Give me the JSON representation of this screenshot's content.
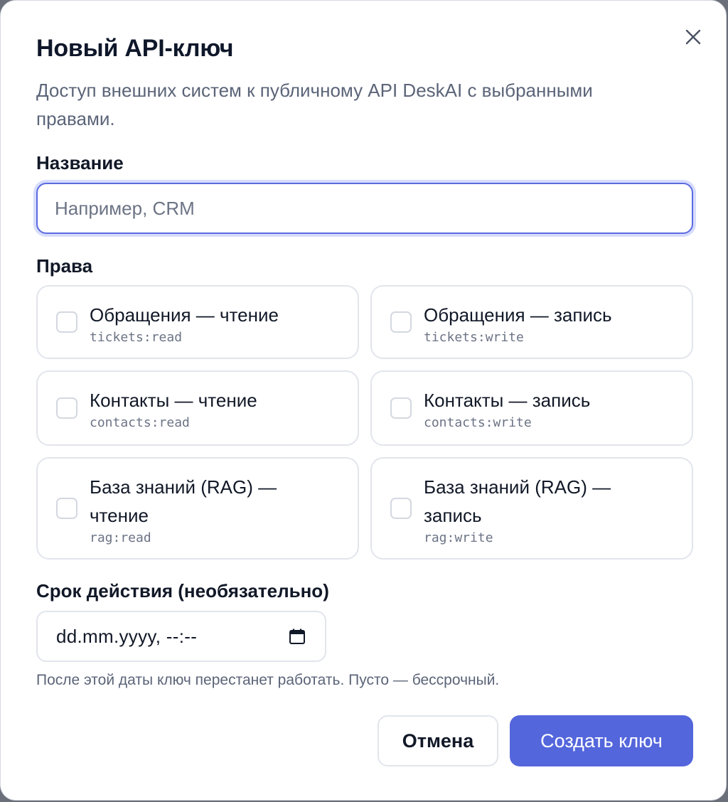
{
  "dialog": {
    "title": "Новый API-ключ",
    "description": "Доступ внешних систем к публичному API DeskAI с выбранными правами."
  },
  "name_field": {
    "label": "Название",
    "placeholder": "Например, CRM",
    "value": ""
  },
  "permissions": {
    "label": "Права",
    "items": [
      {
        "title": "Обращения — чтение",
        "code": "tickets:read",
        "checked": false
      },
      {
        "title": "Обращения — запись",
        "code": "tickets:write",
        "checked": false
      },
      {
        "title": "Контакты — чтение",
        "code": "contacts:read",
        "checked": false
      },
      {
        "title": "Контакты — запись",
        "code": "contacts:write",
        "checked": false
      },
      {
        "title": "База знаний (RAG) — чтение",
        "code": "rag:read",
        "checked": false
      },
      {
        "title": "База знаний (RAG) — запись",
        "code": "rag:write",
        "checked": false
      }
    ]
  },
  "expiry": {
    "label": "Срок действия (необязательно)",
    "value": "dd.mm.yyyy, --:--",
    "hint": "После этой даты ключ перестанет работать. Пусто — бессрочный."
  },
  "buttons": {
    "cancel": "Отмена",
    "create": "Создать ключ"
  },
  "icons": {
    "close": "close-icon",
    "calendar": "calendar-icon"
  },
  "colors": {
    "accent": "#5466dc",
    "focus_ring": "#d6dcfb",
    "muted_text": "#5b6478"
  }
}
